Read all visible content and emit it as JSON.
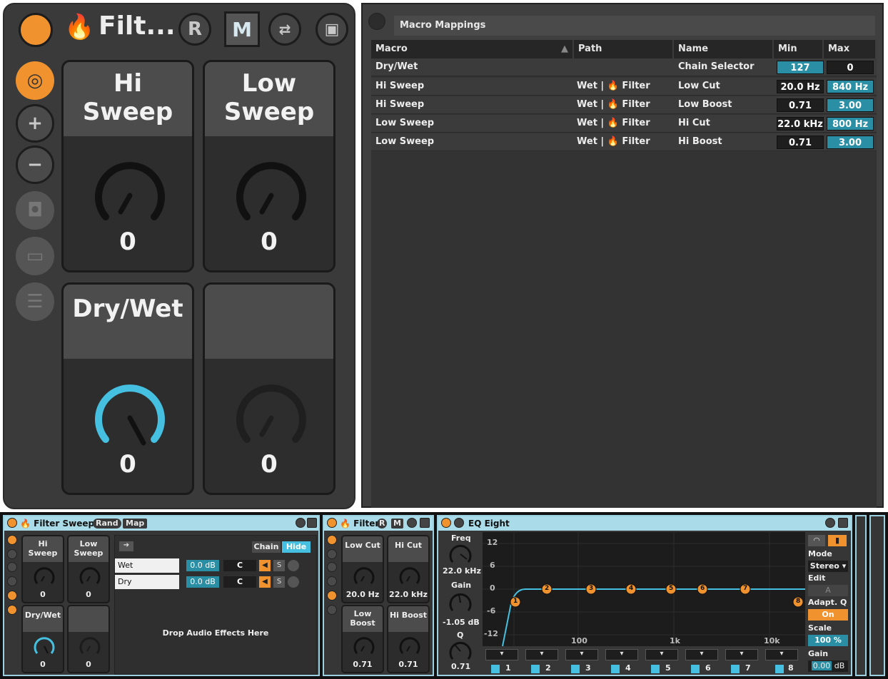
{
  "rack_zoom": {
    "title": "Filt...",
    "rand_label": "R",
    "map_label": "M",
    "macros": [
      {
        "name": "Hi\nSweep",
        "line1": "Hi",
        "line2": "Sweep",
        "value": "0"
      },
      {
        "name": "Low\nSweep",
        "line1": "Low",
        "line2": "Sweep",
        "value": "0"
      },
      {
        "name": "Dry/Wet",
        "line1": "Dry/Wet",
        "line2": "",
        "value": "0"
      },
      {
        "name": "",
        "line1": "",
        "line2": "",
        "value": "0"
      }
    ]
  },
  "mapping": {
    "title": "Macro Mappings",
    "columns": [
      "Macro",
      "Path",
      "Name",
      "Min",
      "Max"
    ],
    "rows": [
      {
        "macro": "Dry/Wet",
        "path": "",
        "name": "Chain Selector",
        "min": "127",
        "max": "0"
      },
      {
        "macro": "Hi Sweep",
        "path": "Wet | 🔥 Filter",
        "name": "Low Cut",
        "min": "20.0 Hz",
        "max": "840 Hz"
      },
      {
        "macro": "Hi Sweep",
        "path": "Wet | 🔥 Filter",
        "name": "Low Boost",
        "min": "0.71",
        "max": "3.00"
      },
      {
        "macro": "Low Sweep",
        "path": "Wet | 🔥 Filter",
        "name": "Hi Cut",
        "min": "22.0 kHz",
        "max": "800 Hz"
      },
      {
        "macro": "Low Sweep",
        "path": "Wet | 🔥 Filter",
        "name": "Hi Boost",
        "min": "0.71",
        "max": "3.00"
      }
    ]
  },
  "filter_sweeps": {
    "title": "🔥 Filter Sweeps",
    "rand": "Rand",
    "map": "Map",
    "chain_label": "Chain",
    "hide_label": "Hide",
    "macros": [
      {
        "line1": "Hi",
        "line2": "Sweep",
        "value": "0"
      },
      {
        "line1": "Low",
        "line2": "Sweep",
        "value": "0"
      },
      {
        "line1": "Dry/Wet",
        "line2": "",
        "value": "0"
      },
      {
        "line1": "",
        "line2": "",
        "value": "0"
      }
    ],
    "chains": [
      {
        "name": "Wet",
        "vol": "0.0 dB",
        "pan": "C",
        "solo": "S"
      },
      {
        "name": "Dry",
        "vol": "0.0 dB",
        "pan": "C",
        "solo": "S"
      }
    ],
    "drop_text": "Drop Audio Effects Here"
  },
  "filter_rack": {
    "title": "🔥 Filter",
    "r": "R",
    "m": "M",
    "macros": [
      {
        "line1": "Low Cut",
        "line2": "",
        "value": "20.0 Hz"
      },
      {
        "line1": "Hi Cut",
        "line2": "",
        "value": "22.0 kHz"
      },
      {
        "line1": "Low",
        "line2": "Boost",
        "value": "0.71"
      },
      {
        "line1": "Hi Boost",
        "line2": "",
        "value": "0.71"
      }
    ]
  },
  "eq_eight": {
    "title": "EQ Eight",
    "freq_label": "Freq",
    "freq_value": "22.0 kHz",
    "gain_label": "Gain",
    "gain_value": "-1.05 dB",
    "q_label": "Q",
    "q_value": "0.71",
    "y_ticks": [
      "12",
      "6",
      "0",
      "-6",
      "-12"
    ],
    "x_ticks": [
      "100",
      "1k",
      "10k"
    ],
    "bands": [
      "1",
      "2",
      "3",
      "4",
      "5",
      "6",
      "7",
      "8"
    ],
    "band_markers": [
      "1",
      "2",
      "3",
      "4",
      "5",
      "6",
      "7",
      "8"
    ],
    "mode_label": "Mode",
    "mode_value": "Stereo",
    "edit_label": "Edit",
    "edit_value": "A",
    "adaptq_label": "Adapt. Q",
    "adaptq_value": "On",
    "scale_label": "Scale",
    "scale_value": "100 %",
    "out_gain_label": "Gain",
    "out_gain_value": "0.00",
    "out_gain_unit": "dB",
    "accent": "#46c0e0"
  }
}
